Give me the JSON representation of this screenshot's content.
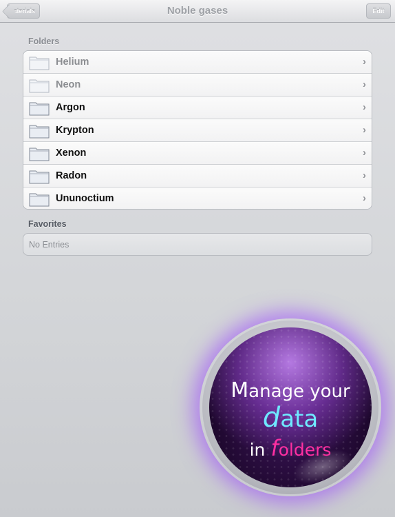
{
  "navbar": {
    "title": "Noble gases",
    "back_label": "Materials",
    "edit_label": "Edit"
  },
  "sections": {
    "folders_header": "Folders",
    "favorites_header": "Favorites",
    "favorites_empty": "No Entries"
  },
  "folders": [
    {
      "label": "Helium",
      "enabled": false
    },
    {
      "label": "Neon",
      "enabled": false
    },
    {
      "label": "Argon",
      "enabled": true
    },
    {
      "label": "Krypton",
      "enabled": true
    },
    {
      "label": "Xenon",
      "enabled": true
    },
    {
      "label": "Radon",
      "enabled": true
    },
    {
      "label": "Ununoctium",
      "enabled": true
    }
  ],
  "badge": {
    "line1_initial": "M",
    "line1_rest": "anage your",
    "line2_initial": "d",
    "line2_rest": "ata",
    "line3_prefix": "in ",
    "line3_initial": "f",
    "line3_rest": "olders",
    "accent_cyan": "#6fe9ff",
    "accent_pink": "#ff2fa2"
  },
  "icons": {
    "folder": "folder-icon",
    "chevron": "chevron-right-icon"
  }
}
